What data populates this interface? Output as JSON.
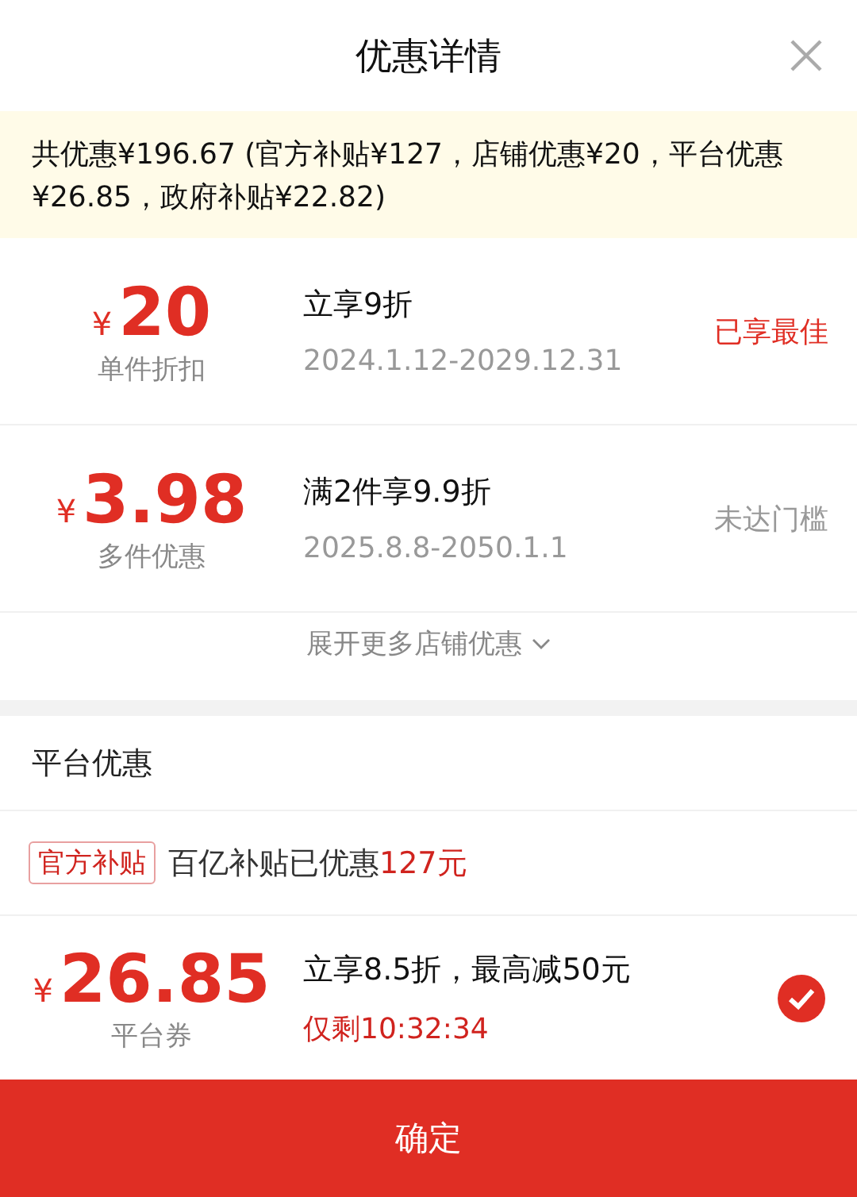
{
  "header": {
    "title": "优惠详情"
  },
  "summary": "共优惠¥196.67 (官方补贴¥127，店铺优惠¥20，平台优惠¥26.85，政府补贴¥22.82)",
  "store_offers": [
    {
      "currency": "¥",
      "amount": "20",
      "label": "单件折扣",
      "title": "立享9折",
      "dates": "2024.1.12-2029.12.31",
      "status": "已享最佳",
      "kind": "best"
    },
    {
      "currency": "¥",
      "amount": "3.98",
      "label": "多件优惠",
      "title": "满2件享9.9折",
      "dates": "2025.8.8-2050.1.1",
      "status": "未达门槛",
      "kind": "unmet"
    }
  ],
  "expand_link": "展开更多店铺优惠",
  "platform": {
    "heading": "平台优惠",
    "subsidy": {
      "badge": "官方补贴",
      "text": "百亿补贴已优惠",
      "highlight": "127元"
    },
    "coupon": {
      "currency": "¥",
      "amount": "26.85",
      "label": "平台券",
      "title": "立享8.5折，最高减50元",
      "countdown": "仅剩10:32:34",
      "selected": true
    }
  },
  "confirm_button": "确定"
}
